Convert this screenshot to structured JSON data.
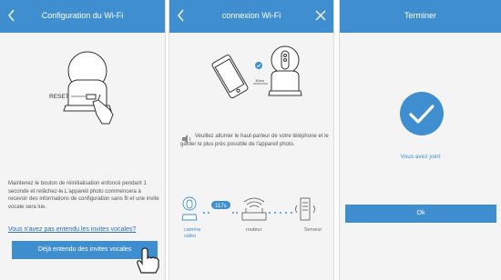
{
  "panel1": {
    "title": "Configuration du Wi-Fi",
    "reset_label": "RESET",
    "instructions": "Maintenez le bouton de réinitialisation enfoncé pendant 1 seconde et relâchez-le.L'appareil photo commencera à recevoir des informations de configuration sans fil et une invite vocale sera lue.",
    "link_text": "Vous n'avez pas entendu les invites vocales?",
    "button_label": "Déjà entendu des invites vocales"
  },
  "panel2": {
    "title": "connexion Wi-Fi",
    "distance_label": "10cm",
    "speaker_text": "Veuillez allumer le haut-parleur de votre téléphone et le garder le plus près possible de l'appareil photo.",
    "timer": "117s",
    "devices": {
      "camera": "caméra\nvidéo",
      "router": "routeur",
      "server": "Serveur"
    }
  },
  "panel3": {
    "title": "Terminer",
    "message": "Vous avez joint",
    "ok_label": "Ok"
  },
  "colors": {
    "accent": "#3f8fd0",
    "link": "#2b6fb2",
    "background": "#f4f4f4"
  },
  "icons": [
    "back-chevron-icon",
    "close-x-icon",
    "speaker-icon",
    "check-icon",
    "hand-pointer-icon",
    "camera-icon",
    "router-icon",
    "server-icon",
    "phone-icon"
  ]
}
